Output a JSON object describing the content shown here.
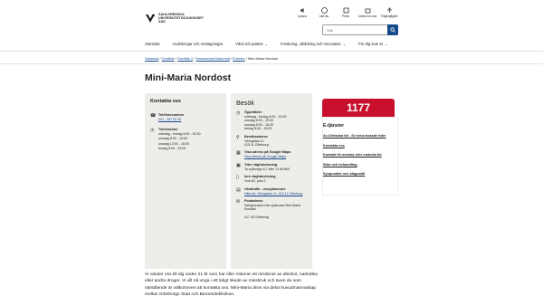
{
  "header": {
    "logo_lines": [
      "SAHLGRENSKA",
      "UNIVERSITETSSJUKHUSET",
      "SÄS"
    ],
    "top_icons": [
      {
        "label": "Lyssna",
        "icon": "speaker-icon"
      },
      {
        "label": "Lätt läs",
        "icon": "easy-read-icon"
      },
      {
        "label": "Press",
        "icon": "press-icon"
      },
      {
        "label": "Jobba hos oss",
        "icon": "jobs-icon"
      },
      {
        "label": "Tillgänglighet",
        "icon": "accessibility-icon"
      }
    ],
    "search_placeholder": "Sök"
  },
  "nav": [
    {
      "label": "Startsida",
      "chevron": false
    },
    {
      "label": "Avdelningar och mottagningar",
      "chevron": false
    },
    {
      "label": "Vård och patient",
      "chevron": true
    },
    {
      "label": "Forskning, utbildning och innovation",
      "chevron": true
    },
    {
      "label": "För dig som är",
      "chevron": true
    }
  ],
  "breadcrumbs": [
    "Startsida",
    "Område",
    "Område 2",
    "Verksamhet Barnmott",
    "Enheter"
  ],
  "breadcrumb_current": "Mini-Maria Nordost",
  "title": "Mini-Maria Nordost",
  "contact": {
    "heading": "Kontakta oss",
    "phone_label": "Telefonnummer",
    "phone": "031 - 367 92 00",
    "hours_label": "Telefontider",
    "hours": [
      "måndag - fredag 8:00 - 16:30",
      "onsdag 8:00 - 19:00",
      "onsdag 13:00 - 16:00",
      "fredag 8:00 - 15:00"
    ]
  },
  "visit": {
    "heading": "Besök",
    "blocks": [
      {
        "icon": "clock-icon",
        "label": "Öppettider",
        "lines": [
          "måndag - fredag 8:00 - 16:30",
          "onsdag 8:00 - 19:00",
          "onsdag 8:00 - 16:30",
          "fredag 8:00 - 15:00"
        ]
      },
      {
        "icon": "pin-icon",
        "label": "Besöksadress",
        "lines": [
          "Vikingatan 11",
          "415 11 Göteborg"
        ]
      },
      {
        "icon": "map-icon",
        "label": "Visa adress på Google Maps",
        "link": "Visa adress på Google Maps"
      },
      {
        "icon": "bus-icon",
        "label": "Yttre väghänvisning",
        "lines": [
          "Ta spårvagn 6,7 eller 11 till BMI"
        ]
      },
      {
        "icon": "door-icon",
        "label": "Inre väghänvisning",
        "lines": [
          "Hus B2, plan 2"
        ]
      },
      {
        "icon": "tram-icon",
        "label": "Västtrafik - reseplanerare",
        "link": "Hitta hit, Vikingatan 11, 415 11 Göteborg"
      },
      {
        "icon": "mail-icon",
        "label": "Postadress",
        "lines": [
          "Sahlgrenska Univ sjukhuset Mini-Maria Nordost",
          "",
          "417 45 Göteborg"
        ]
      }
    ]
  },
  "banner": "1177",
  "etjanster": {
    "heading": "E-tjänster",
    "links": [
      "Av-/Omboka tid - Se mina bokade tider",
      "Kontakta oss",
      "Kontakt för avboka eller omboka tid",
      "Stöd och behandling",
      "Synpunkter och klagomål"
    ]
  },
  "intro": "Vi vänder oss till dig under 21 år som har eller riskerar ett missbruk av alkohol, narkotika eller andra droger. Vi vill nå unga i ett tidigt skede av missbruk och även du som närstående är välkommen att kontakta oss. Mini-Maria drivs via delat huvudmannaskap mellan Göteborgs Stad och Beroendekliniken."
}
